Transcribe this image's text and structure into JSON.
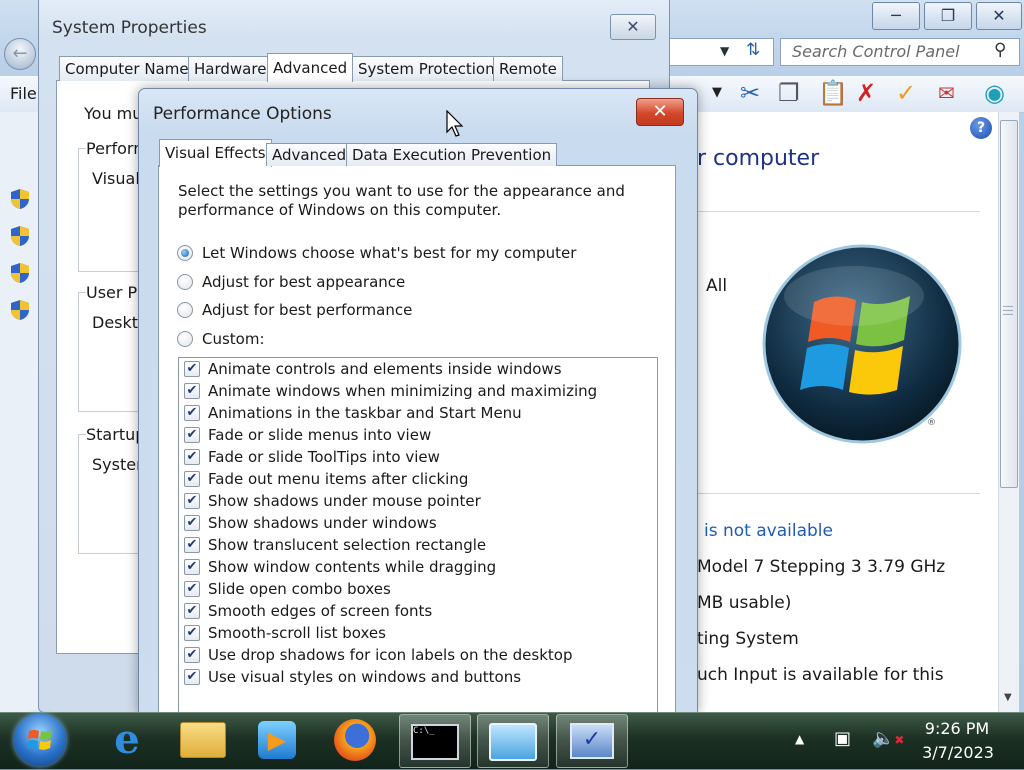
{
  "control_panel": {
    "search_placeholder": "Search Control Panel",
    "menu_file": "File",
    "heading": "r computer",
    "all_label": "All",
    "registered_mark": "®",
    "info_lines": [
      "is not available",
      "Model 7 Stepping 3   3.79 GHz",
      "MB usable)",
      "ting System",
      "uch Input is available for this"
    ]
  },
  "system_properties": {
    "title": "System Properties",
    "tabs": [
      "Computer Name",
      "Hardware",
      "Advanced",
      "System Protection",
      "Remote"
    ],
    "active_tab": "Advanced",
    "intro_text": "You mu",
    "group_performance": "Perform",
    "group_performance_text": "Visual",
    "group_user_profiles": "User Pr",
    "group_user_profiles_text": "Deskto",
    "group_startup": "Startup",
    "group_startup_text": "Syster"
  },
  "performance_options": {
    "title": "Performance Options",
    "tabs": [
      "Visual Effects",
      "Advanced",
      "Data Execution Prevention"
    ],
    "active_tab": "Visual Effects",
    "description": "Select the settings you want to use for the appearance and performance of Windows on this computer.",
    "radio_options": [
      {
        "label": "Let Windows choose what's best for my computer",
        "selected": true
      },
      {
        "label": "Adjust for best appearance",
        "selected": false
      },
      {
        "label": "Adjust for best performance",
        "selected": false
      },
      {
        "label": "Custom:",
        "selected": false
      }
    ],
    "effects": [
      {
        "label": "Animate controls and elements inside windows",
        "checked": true
      },
      {
        "label": "Animate windows when minimizing and maximizing",
        "checked": true
      },
      {
        "label": "Animations in the taskbar and Start Menu",
        "checked": true
      },
      {
        "label": "Fade or slide menus into view",
        "checked": true
      },
      {
        "label": "Fade or slide ToolTips into view",
        "checked": true
      },
      {
        "label": "Fade out menu items after clicking",
        "checked": true
      },
      {
        "label": "Show shadows under mouse pointer",
        "checked": true
      },
      {
        "label": "Show shadows under windows",
        "checked": true
      },
      {
        "label": "Show translucent selection rectangle",
        "checked": true
      },
      {
        "label": "Show window contents while dragging",
        "checked": true
      },
      {
        "label": "Slide open combo boxes",
        "checked": true
      },
      {
        "label": "Smooth edges of screen fonts",
        "checked": true
      },
      {
        "label": "Smooth-scroll list boxes",
        "checked": true
      },
      {
        "label": "Use drop shadows for icon labels on the desktop",
        "checked": true
      },
      {
        "label": "Use visual styles on windows and buttons",
        "checked": true
      }
    ]
  },
  "taskbar": {
    "time": "9:26 PM",
    "date": "3/7/2023",
    "pinned": [
      "internet-explorer",
      "windows-explorer",
      "media-player",
      "firefox",
      "command-prompt",
      "control-panel",
      "system-properties"
    ]
  }
}
